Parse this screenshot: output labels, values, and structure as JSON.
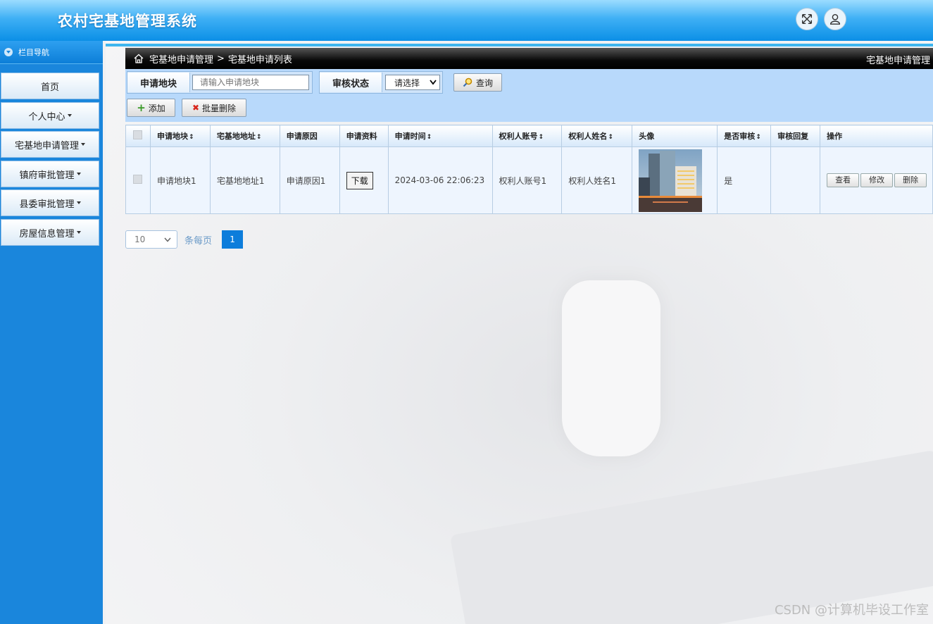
{
  "header": {
    "title": "农村宅基地管理系统",
    "fullscreen_icon": "expand-icon",
    "user_icon": "user-icon"
  },
  "sidebar": {
    "heading": "栏目导航",
    "items": [
      {
        "label": "首页",
        "has_caret": false
      },
      {
        "label": "个人中心",
        "has_caret": true
      },
      {
        "label": "宅基地申请管理",
        "has_caret": true
      },
      {
        "label": "镇府审批管理",
        "has_caret": true
      },
      {
        "label": "县委审批管理",
        "has_caret": true
      },
      {
        "label": "房屋信息管理",
        "has_caret": true
      }
    ]
  },
  "breadcrumb": {
    "level1": "宅基地申请管理",
    "separator": ">",
    "level2": "宅基地申请列表",
    "right_label": "宅基地申请管理"
  },
  "search": {
    "field1_label": "申请地块",
    "field1_placeholder": "请输入申请地块",
    "field2_label": "审核状态",
    "field2_value": "请选择",
    "query_label": "查询"
  },
  "toolbar": {
    "add_label": "添加",
    "batch_delete_label": "批量删除"
  },
  "table": {
    "headers": [
      "申请地块",
      "宅基地地址",
      "申请原因",
      "申请资料",
      "申请时间",
      "权利人账号",
      "权利人姓名",
      "头像",
      "是否审核",
      "审核回复",
      "操作"
    ],
    "rows": [
      {
        "plot": "申请地块1",
        "address": "宅基地地址1",
        "reason": "申请原因1",
        "material": "下载",
        "time": "2024-03-06 22:06:23",
        "account": "权利人账号1",
        "name": "权利人姓名1",
        "reviewed": "是",
        "reply": "",
        "actions": [
          "查看",
          "修改",
          "删除"
        ]
      }
    ]
  },
  "pagination": {
    "page_size": "10",
    "per_page_label": "条每页",
    "current_page": "1"
  },
  "watermark": "CSDN @计算机毕设工作室",
  "colors": {
    "accent": "#0d7ddb",
    "sidebar": "#1a86dc",
    "search_bar": "#b8d9fb"
  }
}
